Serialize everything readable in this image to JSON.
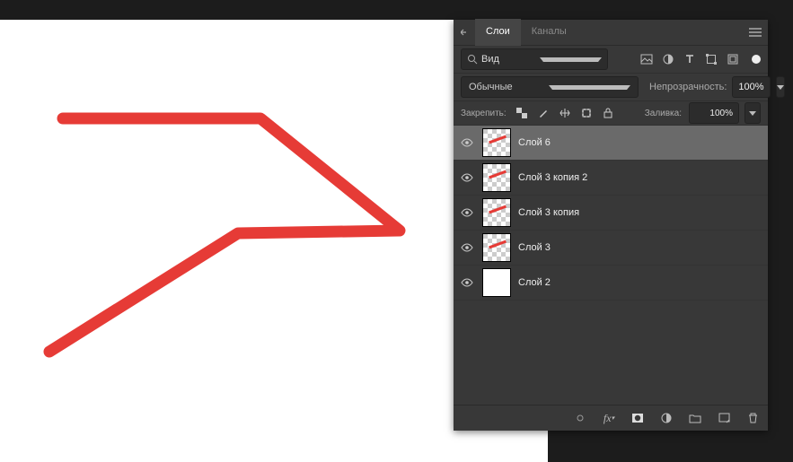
{
  "tabs": {
    "layers": "Слои",
    "channels": "Каналы"
  },
  "filter": {
    "label": "Вид"
  },
  "blend": {
    "mode": "Обычные",
    "opacity_label": "Непрозрачность:",
    "opacity": "100%"
  },
  "lock": {
    "label": "Закрепить:",
    "fill_label": "Заливка:",
    "fill": "100%"
  },
  "layers": [
    {
      "name": "Слой 6",
      "selected": true,
      "checker": true,
      "mark": true
    },
    {
      "name": "Слой 3 копия 2",
      "selected": false,
      "checker": true,
      "mark": true
    },
    {
      "name": "Слой 3 копия",
      "selected": false,
      "checker": true,
      "mark": true
    },
    {
      "name": "Слой 3",
      "selected": false,
      "checker": true,
      "mark": true
    },
    {
      "name": "Слой 2",
      "selected": false,
      "checker": false,
      "mark": false
    }
  ]
}
